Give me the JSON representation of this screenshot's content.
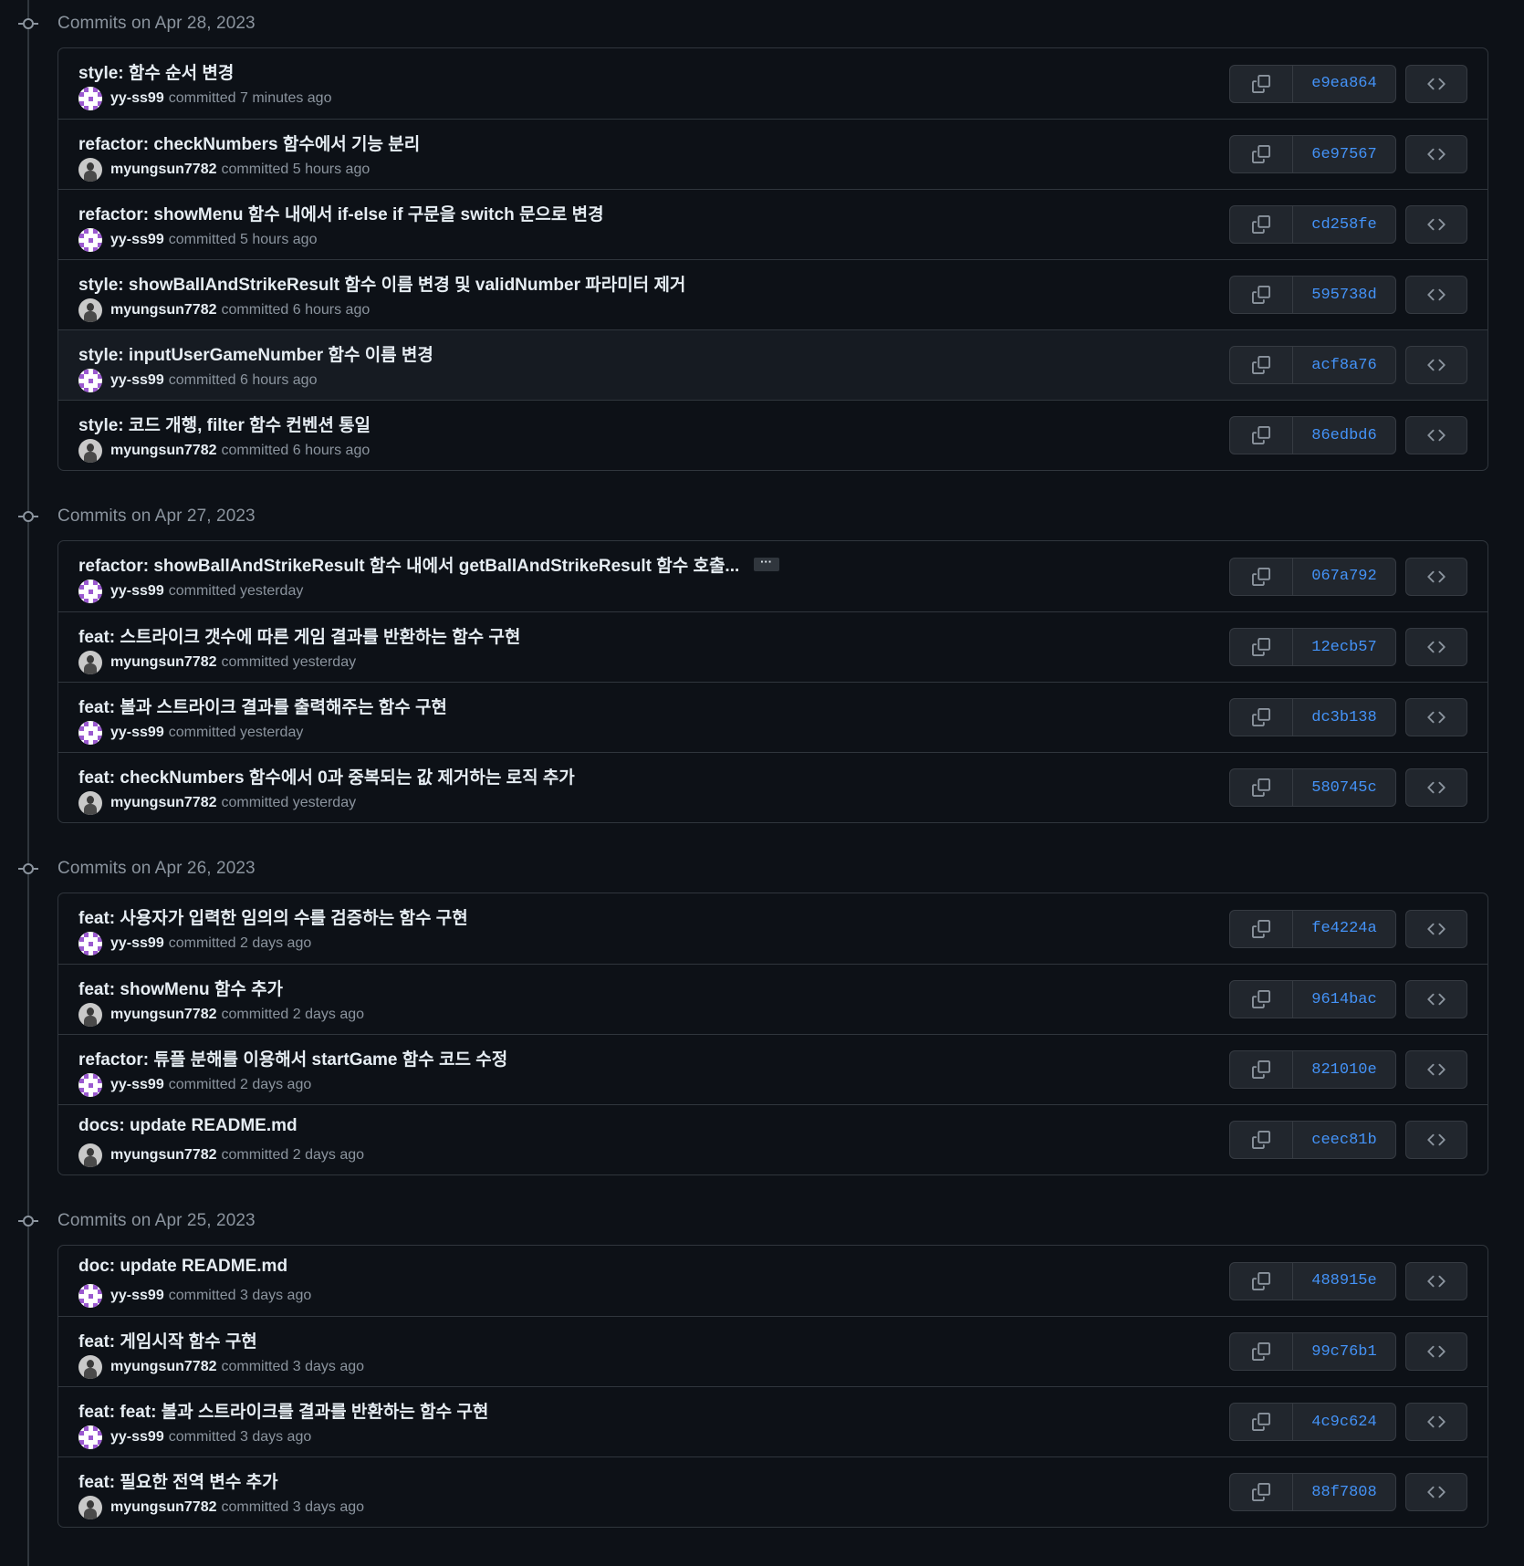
{
  "groups": [
    {
      "title": "Commits on Apr 28, 2023",
      "commits": [
        {
          "message": "style: 함수 순서 변경",
          "author": "yy-ss99",
          "avatar": "identicon",
          "verb": "committed",
          "time": "7 minutes ago",
          "sha": "e9ea864",
          "hovered": false,
          "truncated": false
        },
        {
          "message": "refactor: checkNumbers 함수에서 기능 분리",
          "author": "myungsun7782",
          "avatar": "photo",
          "verb": "committed",
          "time": "5 hours ago",
          "sha": "6e97567",
          "hovered": false,
          "truncated": false
        },
        {
          "message": "refactor: showMenu 함수 내에서 if-else if 구문을 switch 문으로 변경",
          "author": "yy-ss99",
          "avatar": "identicon",
          "verb": "committed",
          "time": "5 hours ago",
          "sha": "cd258fe",
          "hovered": false,
          "truncated": false
        },
        {
          "message": "style: showBallAndStrikeResult 함수 이름 변경 및 validNumber 파라미터 제거",
          "author": "myungsun7782",
          "avatar": "photo",
          "verb": "committed",
          "time": "6 hours ago",
          "sha": "595738d",
          "hovered": false,
          "truncated": false
        },
        {
          "message": "style: inputUserGameNumber 함수 이름 변경",
          "author": "yy-ss99",
          "avatar": "identicon",
          "verb": "committed",
          "time": "6 hours ago",
          "sha": "acf8a76",
          "hovered": true,
          "truncated": false
        },
        {
          "message": "style: 코드 개행, filter 함수 컨벤션 통일",
          "author": "myungsun7782",
          "avatar": "photo",
          "verb": "committed",
          "time": "6 hours ago",
          "sha": "86edbd6",
          "hovered": false,
          "truncated": false
        }
      ]
    },
    {
      "title": "Commits on Apr 27, 2023",
      "commits": [
        {
          "message": "refactor: showBallAndStrikeResult 함수 내에서 getBallAndStrikeResult 함수 호출...",
          "author": "yy-ss99",
          "avatar": "identicon",
          "verb": "committed",
          "time": "yesterday",
          "sha": "067a792",
          "hovered": false,
          "truncated": true
        },
        {
          "message": "feat: 스트라이크 갯수에 따른 게임 결과를 반환하는 함수 구현",
          "author": "myungsun7782",
          "avatar": "photo",
          "verb": "committed",
          "time": "yesterday",
          "sha": "12ecb57",
          "hovered": false,
          "truncated": false
        },
        {
          "message": "feat: 볼과 스트라이크 결과를 출력해주는 함수 구현",
          "author": "yy-ss99",
          "avatar": "identicon",
          "verb": "committed",
          "time": "yesterday",
          "sha": "dc3b138",
          "hovered": false,
          "truncated": false
        },
        {
          "message": "feat: checkNumbers 함수에서 0과 중복되는 값 제거하는 로직 추가",
          "author": "myungsun7782",
          "avatar": "photo",
          "verb": "committed",
          "time": "yesterday",
          "sha": "580745c",
          "hovered": false,
          "truncated": false
        }
      ]
    },
    {
      "title": "Commits on Apr 26, 2023",
      "commits": [
        {
          "message": "feat: 사용자가 입력한 임의의 수를 검증하는 함수 구현",
          "author": "yy-ss99",
          "avatar": "identicon",
          "verb": "committed",
          "time": "2 days ago",
          "sha": "fe4224a",
          "hovered": false,
          "truncated": false
        },
        {
          "message": "feat: showMenu 함수 추가",
          "author": "myungsun7782",
          "avatar": "photo",
          "verb": "committed",
          "time": "2 days ago",
          "sha": "9614bac",
          "hovered": false,
          "truncated": false
        },
        {
          "message": "refactor: 튜플 분해를 이용해서 startGame 함수 코드 수정",
          "author": "yy-ss99",
          "avatar": "identicon",
          "verb": "committed",
          "time": "2 days ago",
          "sha": "821010e",
          "hovered": false,
          "truncated": false
        },
        {
          "message": "docs: update README.md",
          "author": "myungsun7782",
          "avatar": "photo",
          "verb": "committed",
          "time": "2 days ago",
          "sha": "ceec81b",
          "hovered": false,
          "truncated": false
        }
      ]
    },
    {
      "title": "Commits on Apr 25, 2023",
      "commits": [
        {
          "message": "doc: update README.md",
          "author": "yy-ss99",
          "avatar": "identicon",
          "verb": "committed",
          "time": "3 days ago",
          "sha": "488915e",
          "hovered": false,
          "truncated": false
        },
        {
          "message": "feat: 게임시작 함수 구현",
          "author": "myungsun7782",
          "avatar": "photo",
          "verb": "committed",
          "time": "3 days ago",
          "sha": "99c76b1",
          "hovered": false,
          "truncated": false
        },
        {
          "message": "feat: feat: 볼과 스트라이크를 결과를 반환하는 함수 구현",
          "author": "yy-ss99",
          "avatar": "identicon",
          "verb": "committed",
          "time": "3 days ago",
          "sha": "4c9c624",
          "hovered": false,
          "truncated": false
        },
        {
          "message": "feat: 필요한 전역 변수 추가",
          "author": "myungsun7782",
          "avatar": "photo",
          "verb": "committed",
          "time": "3 days ago",
          "sha": "88f7808",
          "hovered": false,
          "truncated": false
        }
      ]
    }
  ],
  "ellipsis_label": "···",
  "icons": {
    "copy": "copy-icon",
    "browse": "code-icon",
    "timeline": "git-commit-icon"
  },
  "colors": {
    "background": "#0d1117",
    "border": "#30363d",
    "link": "#4493f8",
    "muted": "#8b949e",
    "text": "#e6edf3",
    "identicon": "#9b59d0"
  }
}
